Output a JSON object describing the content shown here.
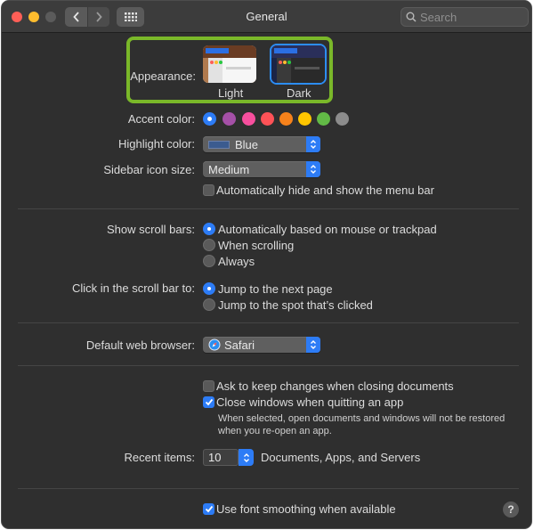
{
  "window": {
    "title": "General"
  },
  "search": {
    "placeholder": "Search"
  },
  "appearance": {
    "label": "Appearance:",
    "options": [
      {
        "label": "Light",
        "selected": false
      },
      {
        "label": "Dark",
        "selected": true
      }
    ]
  },
  "accent": {
    "label": "Accent color:",
    "colors": [
      "#2d7cf6",
      "#a550a7",
      "#f74f9e",
      "#ff5257",
      "#f7821b",
      "#ffc600",
      "#62ba46",
      "#8c8c8c"
    ],
    "selected_index": 0
  },
  "highlight": {
    "label": "Highlight color:",
    "value": "Blue",
    "swatch_color": "#3b5b8f"
  },
  "sidebar_icon_size": {
    "label": "Sidebar icon size:",
    "value": "Medium"
  },
  "menubar": {
    "label": "Automatically hide and show the menu bar",
    "checked": false
  },
  "scroll_bars": {
    "label": "Show scroll bars:",
    "options": [
      {
        "label": "Automatically based on mouse or trackpad",
        "selected": true
      },
      {
        "label": "When scrolling",
        "selected": false
      },
      {
        "label": "Always",
        "selected": false
      }
    ]
  },
  "scroll_click": {
    "label": "Click in the scroll bar to:",
    "options": [
      {
        "label": "Jump to the next page",
        "selected": true
      },
      {
        "label": "Jump to the spot that’s clicked",
        "selected": false
      }
    ]
  },
  "browser": {
    "label": "Default web browser:",
    "value": "Safari"
  },
  "ask_keep_changes": {
    "label": "Ask to keep changes when closing documents",
    "checked": false
  },
  "close_windows": {
    "label": "Close windows when quitting an app",
    "checked": true,
    "note_line1": "When selected, open documents and windows will not be restored",
    "note_line2": "when you re-open an app."
  },
  "recent_items": {
    "label": "Recent items:",
    "value": "10",
    "suffix": "Documents, Apps, and Servers"
  },
  "font_smoothing": {
    "label": "Use font smoothing when available",
    "checked": true
  },
  "help": {
    "label": "?"
  },
  "colors": {
    "accent_blue": "#2d7cf6",
    "highlight_green": "#7ab829",
    "window_bg": "#2f2f2f"
  }
}
